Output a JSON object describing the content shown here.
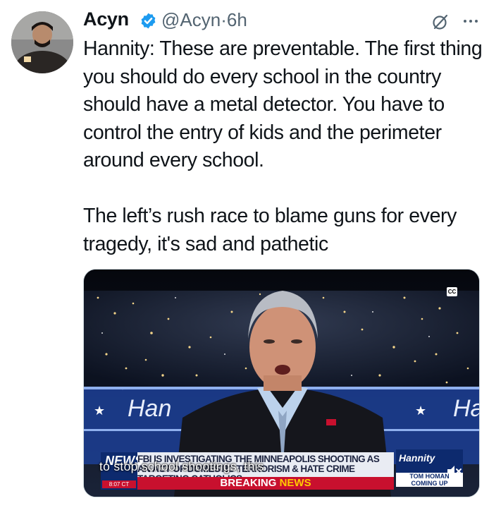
{
  "author": {
    "name": "Acyn",
    "handle": "@Acyn",
    "separator": "·",
    "time": "6h"
  },
  "icons": {
    "verified": "verified-badge-icon",
    "grok": "grok-icon",
    "more": "more-options-icon",
    "mute": "mute-icon",
    "cc": "closed-captions-icon"
  },
  "tweet": {
    "text_p1": "Hannity: These are preventable. The first thing you should do every school in the country should have a metal detector. You have to control the entry of kids and the perimeter around every school.",
    "text_p2": "The left’s rush race to blame guns for every tragedy, it's sad and pathetic"
  },
  "video": {
    "cc_label": "CC",
    "desk_left": "Han",
    "desk_right": "Ha",
    "caption": "to stop school shootings, this",
    "chyron_headline": "FBI is investigating the Minneapolis shooting as an act of domestic terrorism & hate crime targeting Catholics",
    "breaking": "BREAKING",
    "news": "NEWS",
    "channel_logo": "NEWS",
    "clock": "8:07 CT",
    "promo_logo": "Hannity",
    "promo_label": "TOM HOMAN COMING UP"
  },
  "colors": {
    "text": "#0f1419",
    "secondary": "#536471",
    "verified": "#1d9bf0",
    "breaking_red": "#c8102e"
  }
}
